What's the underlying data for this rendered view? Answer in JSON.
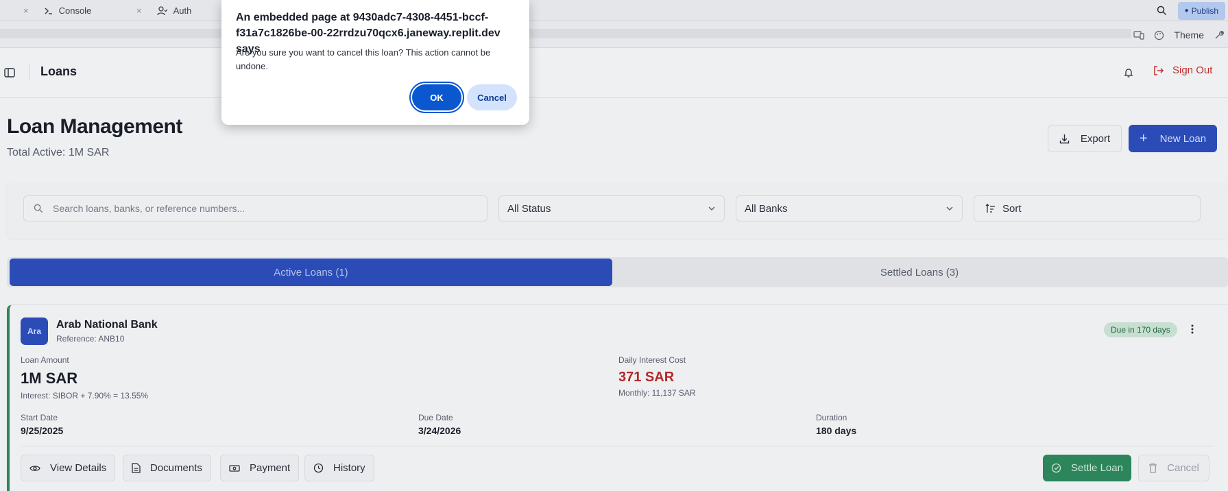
{
  "ide": {
    "tabs": [
      {
        "label": "Console",
        "icon": "terminal-icon"
      },
      {
        "label": "Auth",
        "icon": "user-check-icon"
      }
    ],
    "publish_label": "Publish",
    "theme_label": "Theme"
  },
  "header": {
    "title": "Loans",
    "sign_out_label": "Sign Out"
  },
  "page": {
    "title": "Loan Management",
    "subtitle": "Total Active: 1M SAR",
    "export_label": "Export",
    "new_loan_label": "New Loan"
  },
  "filters": {
    "search_placeholder": "Search loans, banks, or reference numbers...",
    "status_value": "All Status",
    "bank_value": "All Banks",
    "sort_label": "Sort"
  },
  "tabs": {
    "active": "Active Loans (1)",
    "settled": "Settled Loans (3)"
  },
  "loan": {
    "avatar": "Ara",
    "bank": "Arab National Bank",
    "reference": "Reference: ANB10",
    "due_badge": "Due in 170 days",
    "amount_label": "Loan Amount",
    "amount": "1M SAR",
    "interest": "Interest: SIBOR + 7.90% = 13.55%",
    "daily_label": "Daily Interest Cost",
    "daily": "371 SAR",
    "monthly": "Monthly: 11,137 SAR",
    "start_label": "Start Date",
    "start": "9/25/2025",
    "due_label": "Due Date",
    "due": "3/24/2026",
    "duration_label": "Duration",
    "duration": "180 days",
    "actions": {
      "view": "View Details",
      "documents": "Documents",
      "payment": "Payment",
      "history": "History",
      "settle": "Settle Loan",
      "cancel": "Cancel"
    }
  },
  "dialog": {
    "title": "An embedded page at 9430adc7-4308-4451-bccf-f31a7c1826be-00-22rrdzu70qcx6.janeway.replit.dev says",
    "message": "Are you sure you want to cancel this loan? This action cannot be undone.",
    "ok": "OK",
    "cancel": "Cancel"
  },
  "colors": {
    "primary": "#2d4fbd",
    "success": "#2e8a5e",
    "danger": "#b82b2b",
    "dialog_ok": "#0b57d0"
  }
}
